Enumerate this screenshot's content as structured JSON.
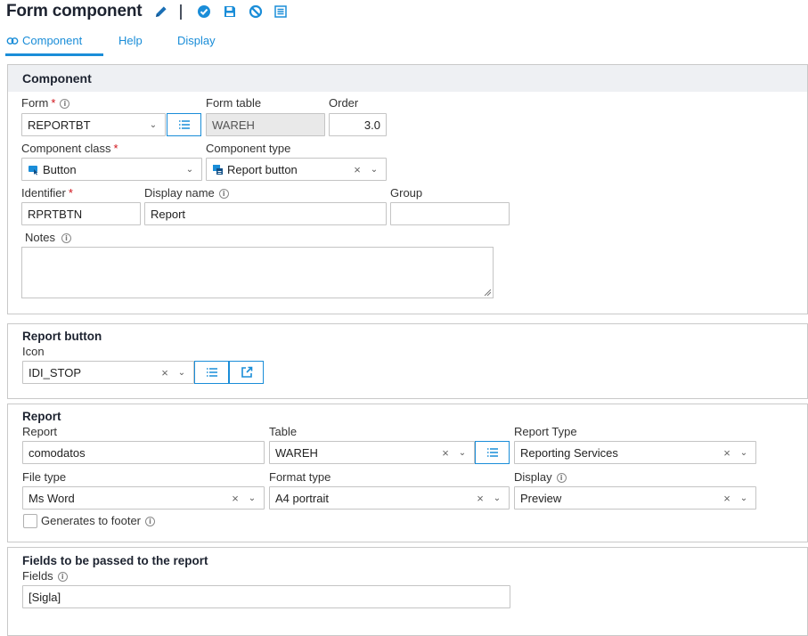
{
  "header": {
    "title": "Form component",
    "toolbar_icons": [
      "pencil-icon",
      "check-circle-icon",
      "save-icon",
      "cancel-icon",
      "list-icon"
    ]
  },
  "tabs": [
    {
      "label": "Component",
      "active": true
    },
    {
      "label": "Help",
      "active": false
    },
    {
      "label": "Display",
      "active": false
    }
  ],
  "component": {
    "title": "Component",
    "form_label": "Form",
    "form_value": "REPORTBT",
    "form_table_label": "Form table",
    "form_table_value": "WAREH",
    "order_label": "Order",
    "order_value": "3.0",
    "component_class_label": "Component class",
    "component_class_value": "Button",
    "component_type_label": "Component type",
    "component_type_value": "Report button",
    "identifier_label": "Identifier",
    "identifier_value": "RPRTBTN",
    "display_name_label": "Display name",
    "display_name_value": "Report",
    "group_label": "Group",
    "group_value": "",
    "notes_label": "Notes",
    "notes_value": ""
  },
  "report_button": {
    "title": "Report button",
    "icon_label": "Icon",
    "icon_value": "IDI_STOP"
  },
  "report": {
    "title": "Report",
    "report_label": "Report",
    "report_value": "comodatos",
    "table_label": "Table",
    "table_value": "WAREH",
    "report_type_label": "Report Type",
    "report_type_value": "Reporting Services",
    "file_type_label": "File type",
    "file_type_value": "Ms Word",
    "format_type_label": "Format type",
    "format_type_value": "A4 portrait",
    "display_label": "Display",
    "display_value": "Preview",
    "generates_footer_label": "Generates to footer",
    "generates_footer_checked": false
  },
  "fields_section": {
    "title": "Fields to be passed to the report",
    "fields_label": "Fields",
    "fields_value": "[Sigla]"
  },
  "colors": {
    "accent": "#1a8dd8",
    "required": "#d0121a",
    "panel_header": "#eef0f3"
  }
}
